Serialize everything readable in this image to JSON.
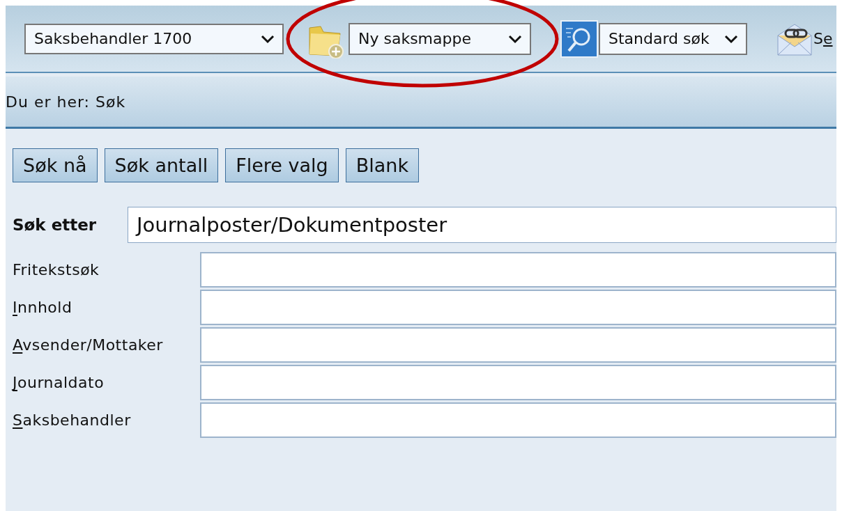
{
  "toolbar": {
    "user_select": {
      "value": "Saksbehandler 1700"
    },
    "new_select": {
      "value": "Ny saksmappe"
    },
    "search_select": {
      "value": "Standard søk"
    },
    "mail_link": {
      "label": "Se"
    }
  },
  "breadcrumb": "Du er her: Søk",
  "buttons": [
    "Søk nå",
    "Søk antall",
    "Flere valg",
    "Blank"
  ],
  "search_for": {
    "label": "Søk etter",
    "value": "Journalposter/Dokumentposter"
  },
  "fields": [
    {
      "label": "Fritekstsøk",
      "access_key": false
    },
    {
      "label": "Innhold",
      "access_key": true
    },
    {
      "label": "Avsender/Mottaker",
      "access_key": true
    },
    {
      "label": "Journaldato",
      "access_key": true
    },
    {
      "label": "Saksbehandler",
      "access_key": true
    }
  ],
  "annotations": [
    {
      "kind": "ellipse",
      "color": "#c00000"
    }
  ]
}
